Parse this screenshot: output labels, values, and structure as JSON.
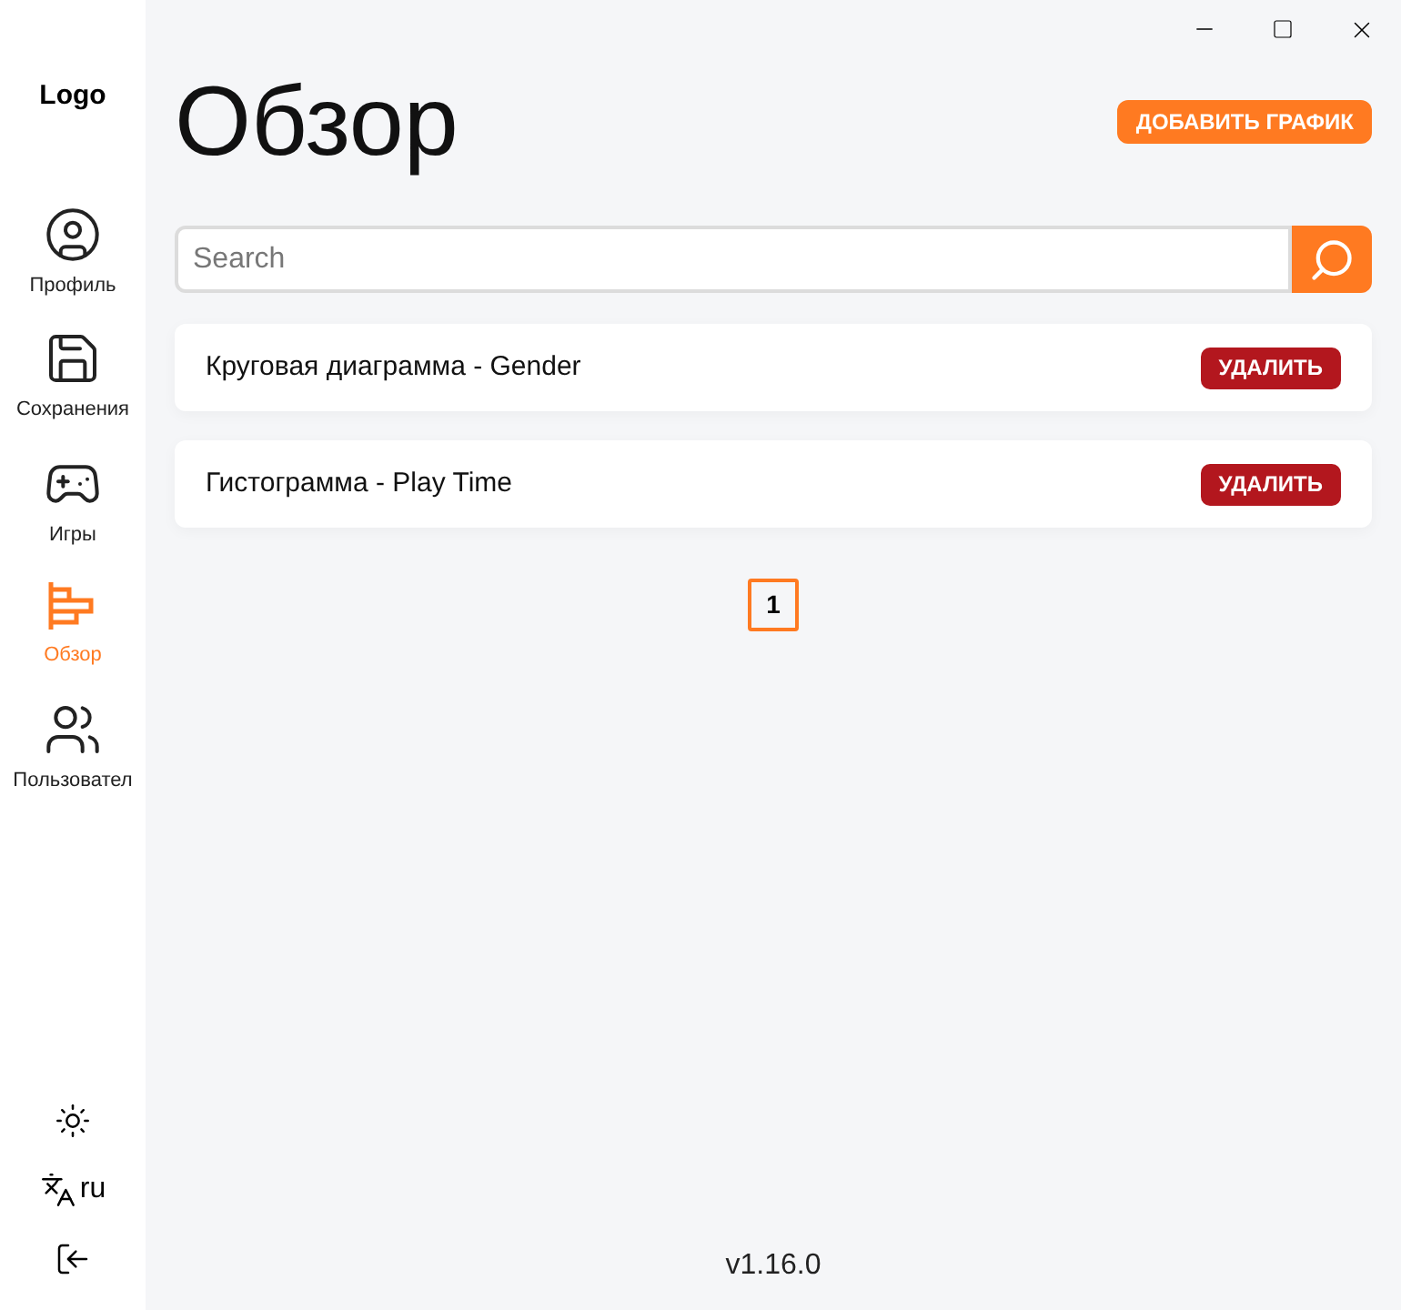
{
  "sidebar": {
    "logo": "Logo",
    "items": [
      {
        "kind": "profile",
        "label": "Профиль",
        "selected": false
      },
      {
        "kind": "saves",
        "label": "Сохранения",
        "selected": false
      },
      {
        "kind": "games",
        "label": "Игры",
        "selected": false
      },
      {
        "kind": "overview",
        "label": "Обзор",
        "selected": true
      },
      {
        "kind": "users",
        "label": "Пользовател",
        "selected": false
      }
    ],
    "language": "ru"
  },
  "page": {
    "title": "Обзор",
    "add_button": "ДОБАВИТЬ ГРАФИК",
    "search": {
      "placeholder": "Search"
    },
    "charts": [
      {
        "name": "Круговая диаграмма - Gender",
        "delete_button": "УДАЛИТЬ"
      },
      {
        "name": "Гистограмма - Play Time",
        "delete_button": "УДАЛИТЬ"
      }
    ],
    "pages": [
      {
        "label": "1",
        "selected": true
      }
    ],
    "version": "v1.16.0"
  }
}
